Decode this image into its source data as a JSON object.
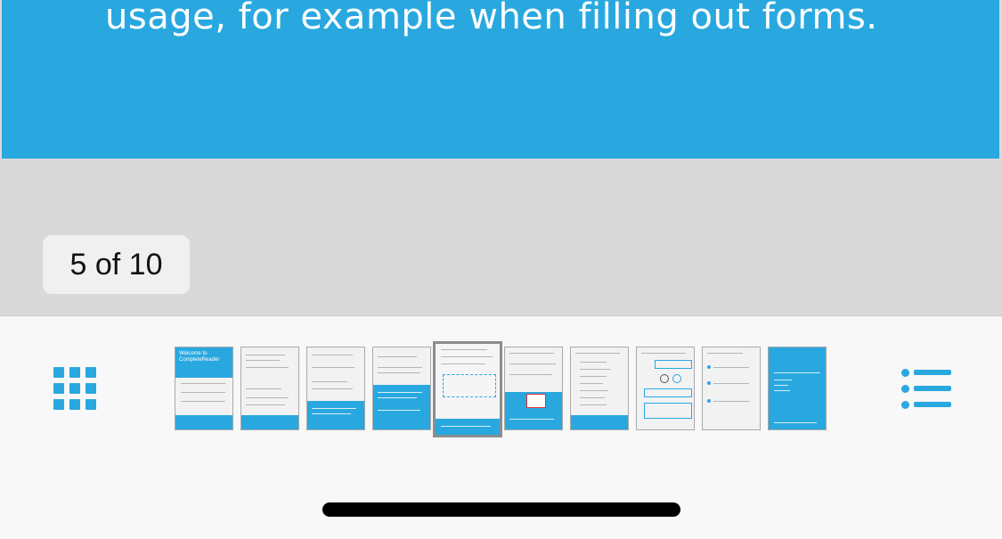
{
  "banner": {
    "text": "usage, for example when filling out forms."
  },
  "page_indicator": {
    "text": "5 of 10",
    "current": 5,
    "total": 10
  },
  "toolbar": {
    "left_icon": "grid-icon",
    "right_icon": "list-icon"
  },
  "thumbnails": {
    "count": 10,
    "active_index": 4,
    "first_page_title": "Welcome to CompleteReader"
  },
  "colors": {
    "accent": "#29a8e0",
    "background": "#d9d9d9",
    "toolbar": "#f8f8f8"
  }
}
